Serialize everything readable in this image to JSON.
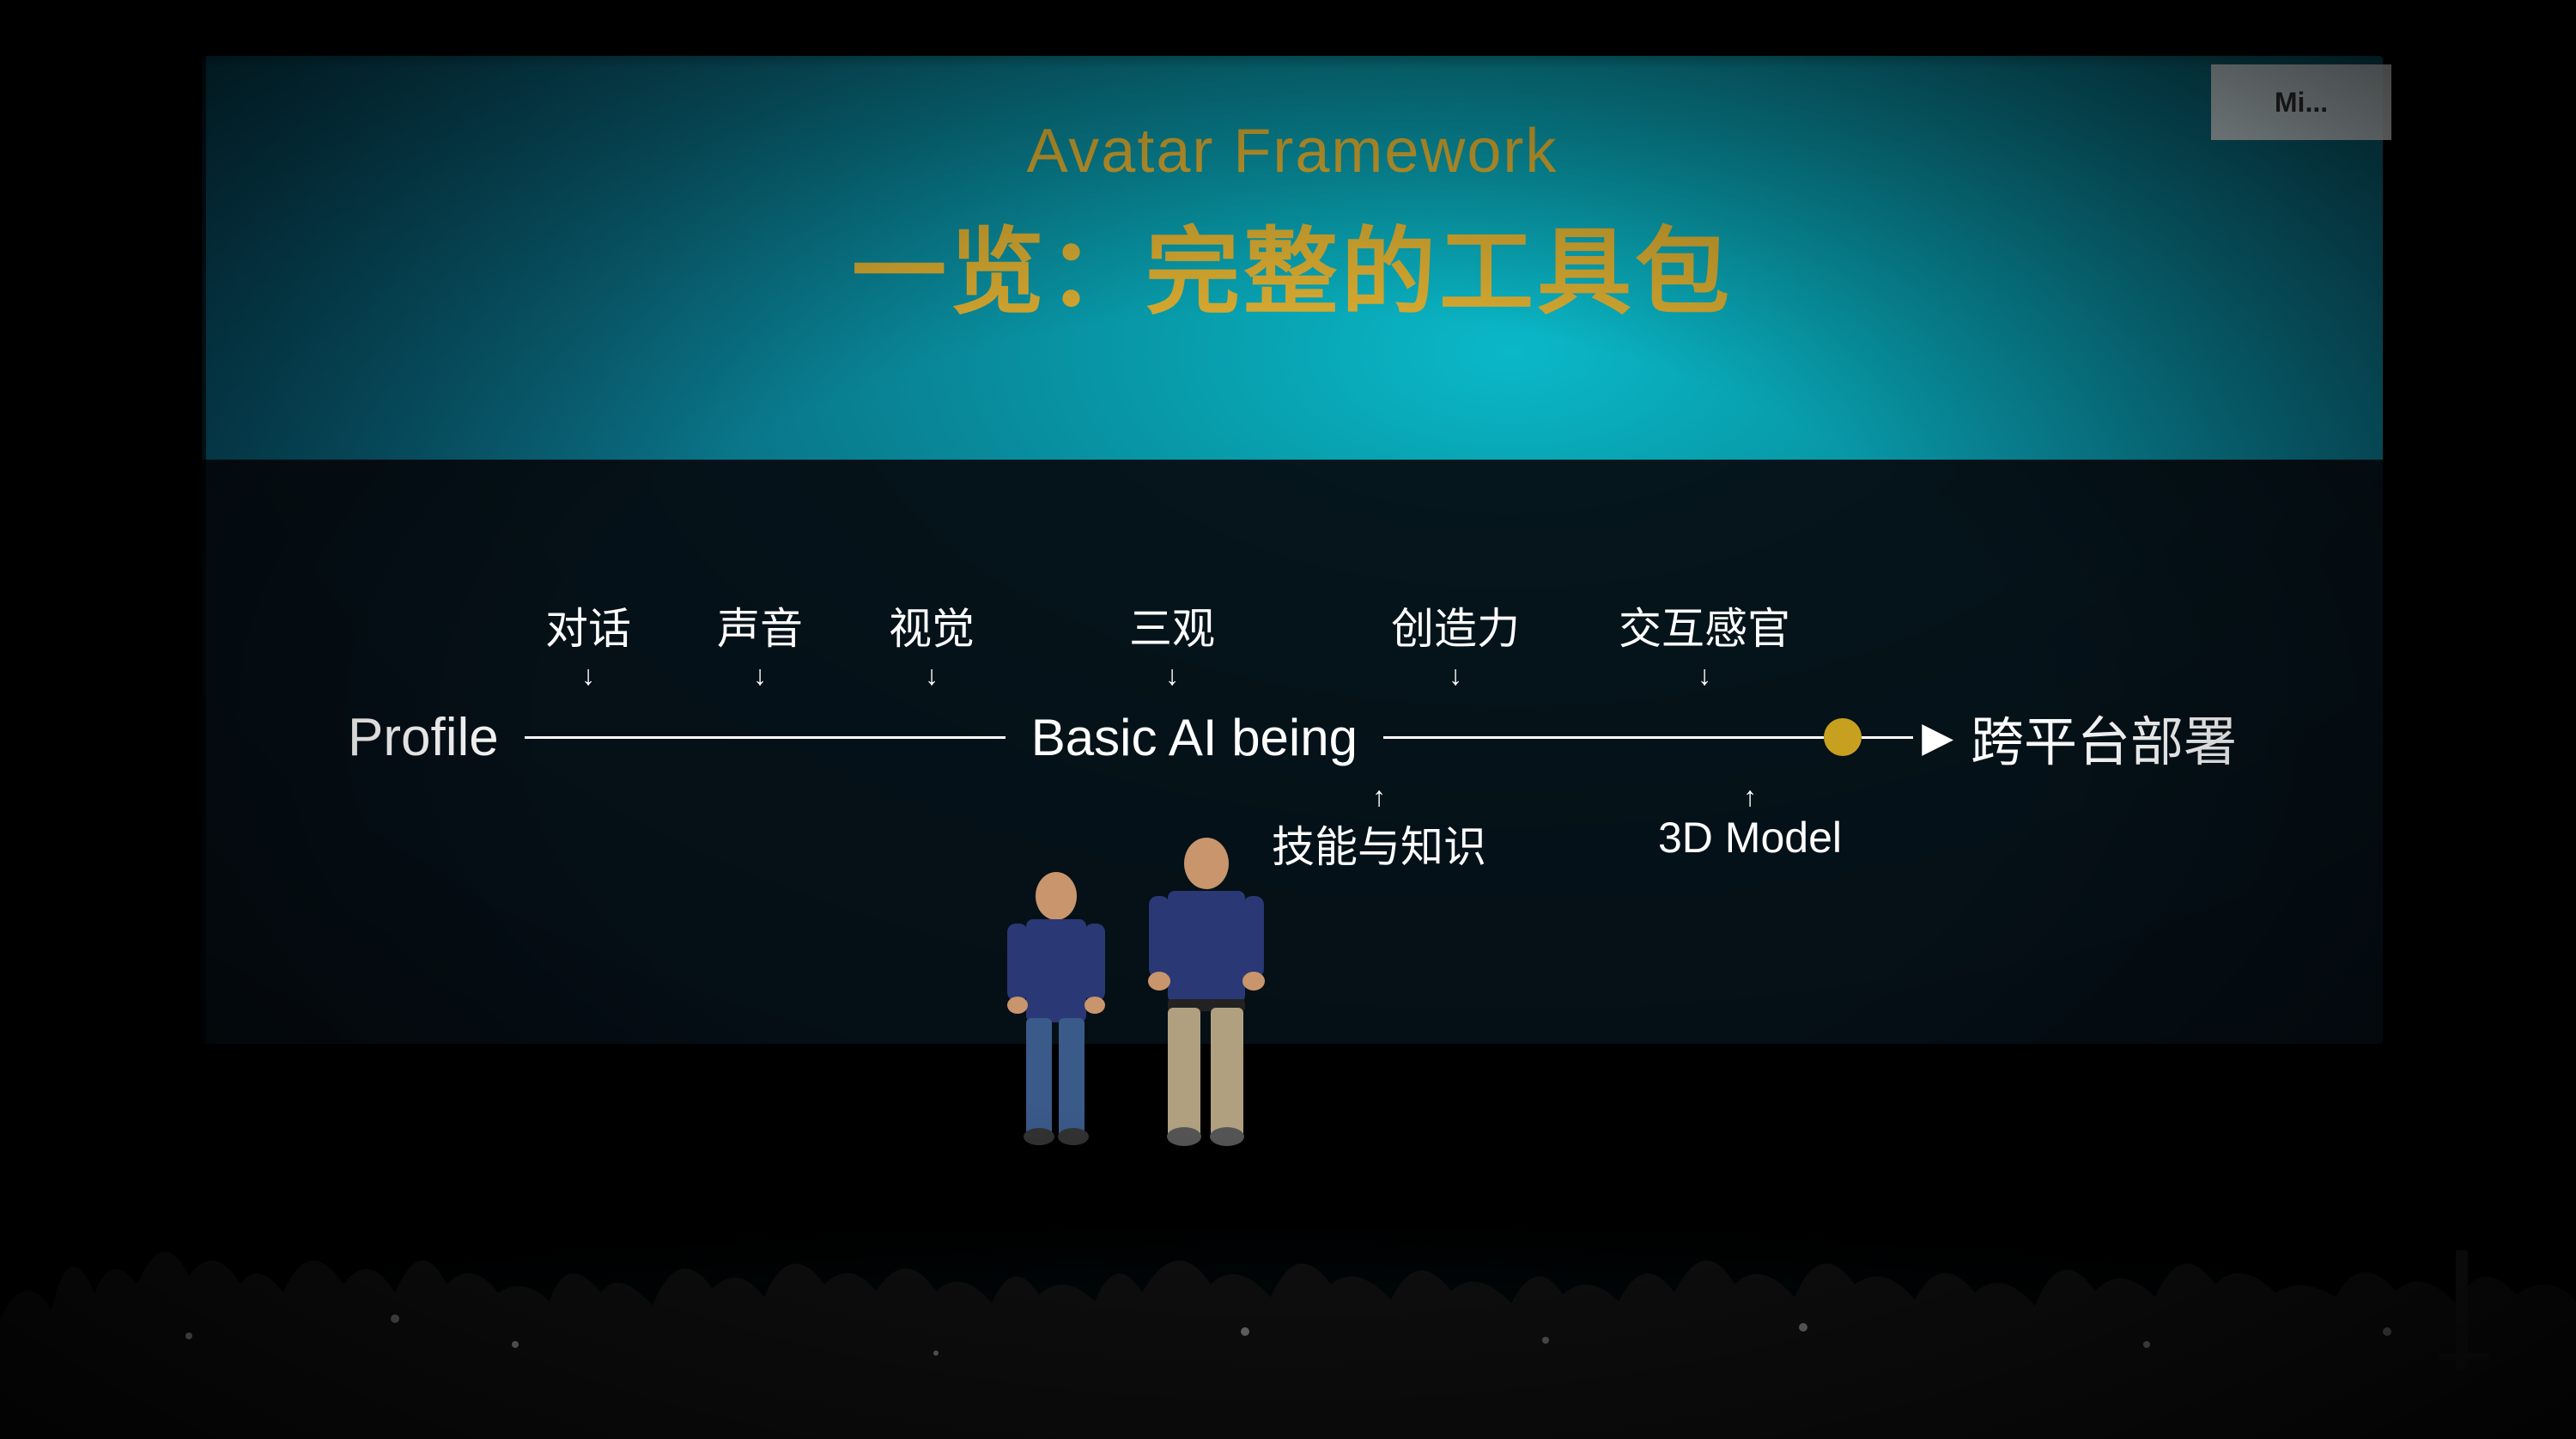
{
  "slide": {
    "title_en": "Avatar Framework",
    "title_zh": "一览：完整的工具包",
    "bg_color_center": "#0ab8c8",
    "bg_color_edge": "#032535",
    "accent_color": "#d4a830"
  },
  "diagram": {
    "top_labels": [
      {
        "zh": "对话",
        "arrow": "↓"
      },
      {
        "zh": "声音",
        "arrow": "↓"
      },
      {
        "zh": "视觉",
        "arrow": "↓"
      },
      {
        "zh": "三观",
        "arrow": "↓"
      },
      {
        "zh": "创造力",
        "arrow": "↓"
      },
      {
        "zh": "交互感官",
        "arrow": "↓"
      }
    ],
    "timeline": {
      "start_label": "Profile",
      "mid_label": "Basic AI being",
      "dot_color": "#d4a830",
      "arrow": "→",
      "end_label": "跨平台部署"
    },
    "bottom_labels": [
      {
        "zh": "技能与知识",
        "arrow": "↑"
      },
      {
        "zh": "3D Model",
        "arrow": "↑"
      }
    ]
  },
  "corner_sign": {
    "text": "Mi..."
  }
}
